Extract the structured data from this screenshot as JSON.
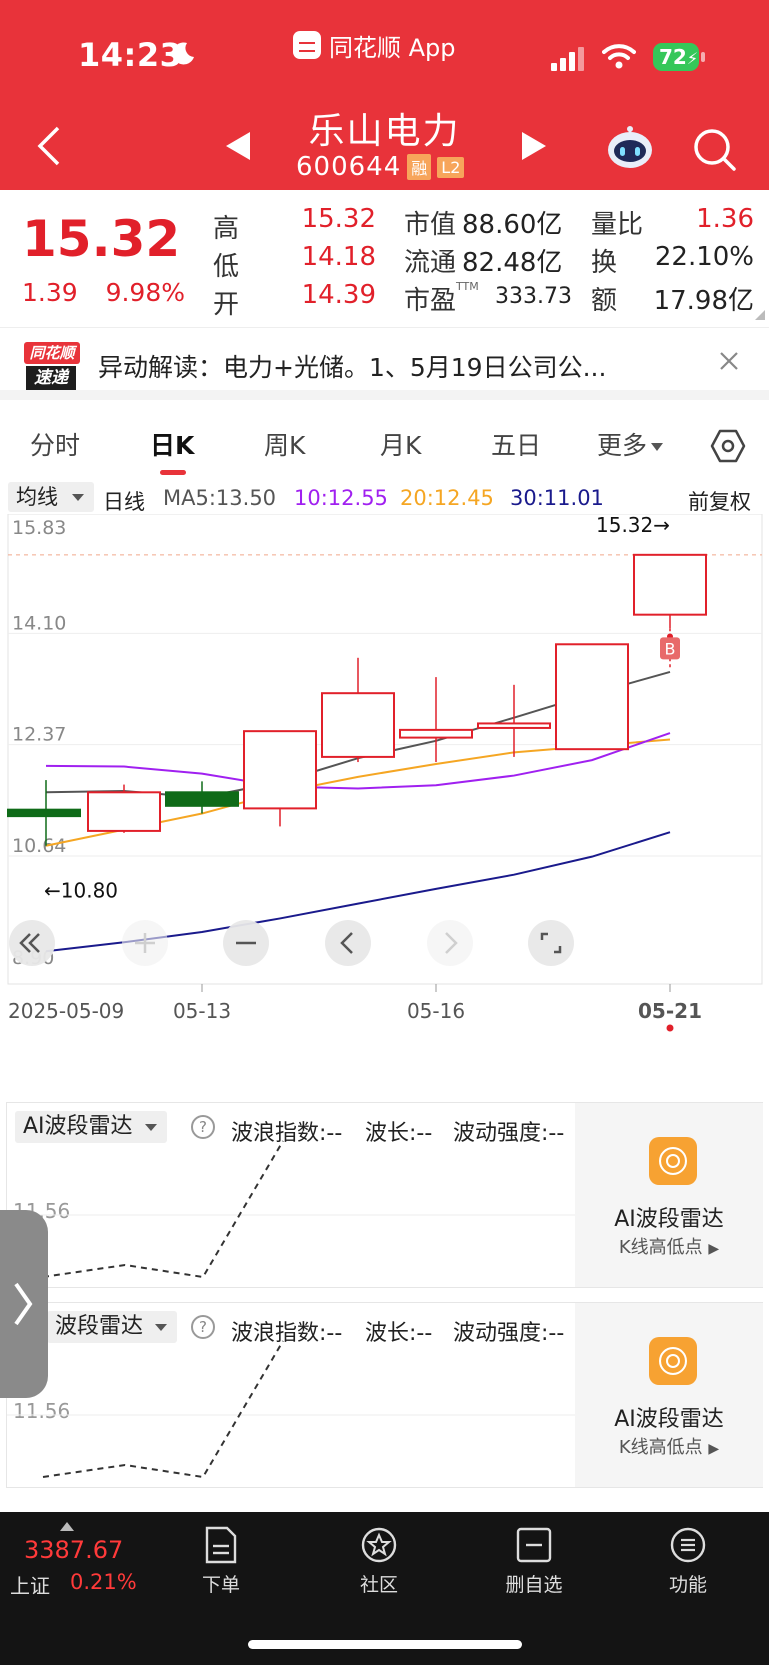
{
  "status": {
    "time": "14:23",
    "battery": "72"
  },
  "app": {
    "name": "同花顺 App"
  },
  "stock": {
    "name": "乐山电力",
    "code": "600644",
    "tags": [
      "融",
      "L2"
    ]
  },
  "quote": {
    "price": "15.32",
    "change": "1.39",
    "change_pct": "9.98%",
    "high_label": "高",
    "high": "15.32",
    "low_label": "低",
    "low": "14.18",
    "open_label": "开",
    "open": "14.39",
    "mcap_label": "市值",
    "mcap": "88.60亿",
    "float_label": "流通",
    "float": "82.48亿",
    "pe_label": "市盈",
    "pe_sup": "TTM",
    "pe": "333.73",
    "vr_label": "量比",
    "vr": "1.36",
    "turn_label": "换",
    "turn": "22.10%",
    "amt_label": "额",
    "amt": "17.98亿"
  },
  "news": {
    "logo_top": "同花顺",
    "logo_bottom": "速递",
    "text": "异动解读：电力+光储。1、5月19日公司公..."
  },
  "tabs": {
    "items": [
      "分时",
      "日K",
      "周K",
      "月K",
      "五日",
      "更多"
    ],
    "active": "日K"
  },
  "ma": {
    "select": "均线",
    "period": "日线",
    "ma5": "MA5:13.50",
    "ma10": "10:12.55",
    "ma20": "20:12.45",
    "ma30": "30:11.01",
    "adjust": "前复权"
  },
  "chart_data": {
    "type": "candlestick",
    "y_ticks": [
      "15.83",
      "14.10",
      "12.37",
      "10.64",
      "8.90"
    ],
    "ylim": [
      8.9,
      15.83
    ],
    "x_labels": [
      "2025-05-09",
      "05-13",
      "05-16",
      "05-21"
    ],
    "annotations": {
      "high": "15.32→",
      "low": "←10.80",
      "buy_marker": "B"
    },
    "colors": {
      "up": "#e1202a",
      "down": "#0f6b18",
      "ma5": "#555555",
      "ma10": "#a020f0",
      "ma20": "#f5a623",
      "ma30": "#1a1a8c"
    },
    "candles": [
      {
        "date": "2025-05-09",
        "open": 11.36,
        "close": 11.26,
        "high": 11.82,
        "low": 10.8
      },
      {
        "date": "2025-05-12",
        "open": 11.03,
        "close": 11.63,
        "high": 11.75,
        "low": 11.0
      },
      {
        "date": "2025-05-13",
        "open": 11.63,
        "close": 11.42,
        "high": 11.8,
        "low": 11.3
      },
      {
        "date": "2025-05-14",
        "open": 11.38,
        "close": 12.58,
        "high": 12.58,
        "low": 11.1
      },
      {
        "date": "2025-05-15",
        "open": 12.18,
        "close": 13.17,
        "high": 13.72,
        "low": 12.1
      },
      {
        "date": "2025-05-16",
        "open": 12.48,
        "close": 12.6,
        "high": 13.42,
        "low": 12.1
      },
      {
        "date": "2025-05-19",
        "open": 12.63,
        "close": 12.7,
        "high": 13.3,
        "low": 12.18
      },
      {
        "date": "2025-05-20",
        "open": 12.3,
        "close": 13.93,
        "high": 13.93,
        "low": 12.3
      },
      {
        "date": "2025-05-21",
        "open": 14.39,
        "close": 15.32,
        "high": 15.32,
        "low": 14.18
      }
    ],
    "ma5": [
      11.63,
      11.65,
      11.55,
      11.79,
      12.16,
      12.43,
      12.79,
      13.16,
      13.5
    ],
    "ma10": [
      12.04,
      12.03,
      11.92,
      11.72,
      11.69,
      11.74,
      11.89,
      12.13,
      12.55
    ],
    "ma20": [
      10.8,
      11.05,
      11.3,
      11.63,
      11.87,
      12.07,
      12.25,
      12.35,
      12.45
    ],
    "ma30": [
      9.16,
      9.3,
      9.46,
      9.67,
      9.9,
      10.13,
      10.35,
      10.63,
      11.01
    ],
    "controls": [
      "collapse",
      "zoom-in",
      "zoom-out",
      "prev",
      "next",
      "fullscreen"
    ]
  },
  "radar": [
    {
      "select": "AI波段雷达",
      "wave_index": "波浪指数:--",
      "wavelength": "波长:--",
      "intensity": "波动强度:--",
      "side_title": "AI波段雷达",
      "side_sub": "K线高低点",
      "value": "11.56"
    },
    {
      "select": "波段雷达",
      "wave_index": "波浪指数:--",
      "wavelength": "波长:--",
      "intensity": "波动强度:--",
      "side_title": "AI波段雷达",
      "side_sub": "K线高低点",
      "value": "11.56"
    }
  ],
  "bottom": {
    "index_value": "3387.67",
    "index_name": "上证",
    "index_change": "0.21%",
    "items": [
      "下单",
      "社区",
      "删自选",
      "功能"
    ]
  }
}
